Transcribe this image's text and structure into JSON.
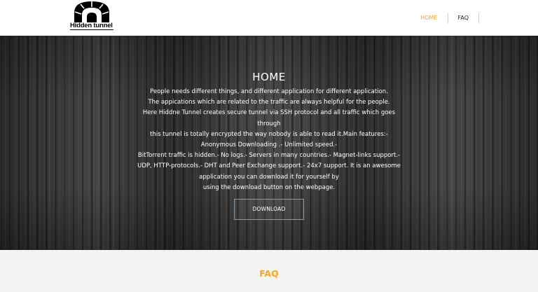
{
  "header": {
    "logo_text": "Hidden tunnel",
    "nav": [
      {
        "label": "HOME",
        "active": true
      },
      {
        "label": "FAQ",
        "active": false
      }
    ],
    "accent_color": "#f5a623"
  },
  "hero": {
    "title": "HOME",
    "lines": [
      "People needs different things, and different application for different application.",
      "The appications which are related to the traffic are always helpful for the people.",
      "Here Hiddne Tunnel creates secure tunnel via SSH protocol and all traffic which goes",
      "through",
      "this tunnel is totally encrypted the way nobody is able to read it.Main features:-",
      "Anonymous Downloading .- Unlimited speed.-",
      "BitTorrent traffic is hidden.- No logs.- Servers in many countries.- Magnet-links support.- UDP, HTTP-protocols.- DHT and Peer Exchange support.- 24x7 support. It is an awesome application you can download it for yourself by",
      "using the download button on the webpage."
    ],
    "button_label": "DOWNLOAD"
  },
  "faq_section": {
    "title": "FAQ"
  }
}
